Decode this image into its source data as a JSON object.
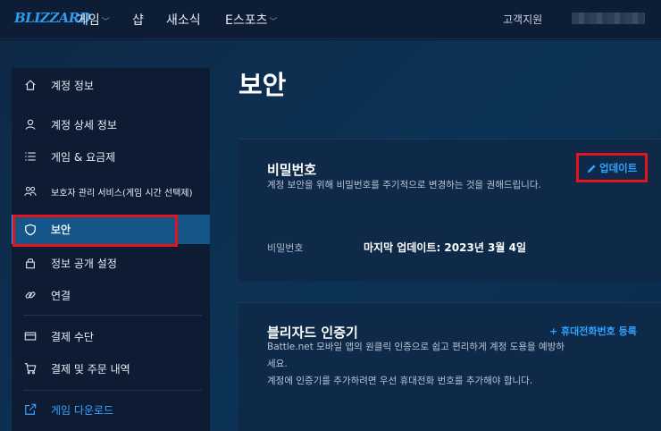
{
  "header": {
    "logo": "BLIZZARD",
    "nav": [
      {
        "label": "게임",
        "dropdown": true
      },
      {
        "label": "샵",
        "dropdown": false
      },
      {
        "label": "새소식",
        "dropdown": false
      },
      {
        "label": "E스포츠",
        "dropdown": true
      }
    ],
    "support": "고객지원"
  },
  "sidebar": {
    "items": [
      {
        "label": "계정 정보",
        "icon": "home-icon"
      },
      {
        "label": "계정 상세 정보",
        "icon": "user-icon"
      },
      {
        "label": "게임 & 요금제",
        "icon": "list-icon"
      },
      {
        "label": "보호자 관리 서비스(게임 시간 선택제)",
        "icon": "parents-icon"
      },
      {
        "label": "보안",
        "icon": "shield-icon",
        "active": true
      },
      {
        "label": "정보 공개 설정",
        "icon": "lock-icon"
      },
      {
        "label": "연결",
        "icon": "link-icon"
      },
      {
        "label": "결제 수단",
        "icon": "card-icon"
      },
      {
        "label": "결제 및 주문 내역",
        "icon": "cart-icon"
      },
      {
        "label": "게임 다운로드",
        "icon": "external-link-icon"
      }
    ]
  },
  "main": {
    "title": "보안",
    "password_card": {
      "title": "비밀번호",
      "desc": "계정 보안을 위해 비밀번호를 주기적으로 변경하는 것을 권해드립니다.",
      "update_label": "업데이트",
      "field_label": "비밀번호",
      "field_value": "마지막 업데이트: 2023년 3월 4일"
    },
    "authenticator_card": {
      "title": "블리자드 인증기",
      "add_label": "+ 휴대전화번호 등록",
      "desc_line1": "Battle.net 모바일 앱의 원클릭 인증으로 쉽고 편리하게 계정 도용을 예방하",
      "desc_line2": "세요.",
      "desc_line3": "계정에 인증기를 추가하려면 우선 휴대전화 번호를 추가해야 합니다."
    }
  },
  "colors": {
    "accent": "#2fa1ff",
    "active_bg": "#14568a",
    "highlight_box": "#e3141b"
  }
}
